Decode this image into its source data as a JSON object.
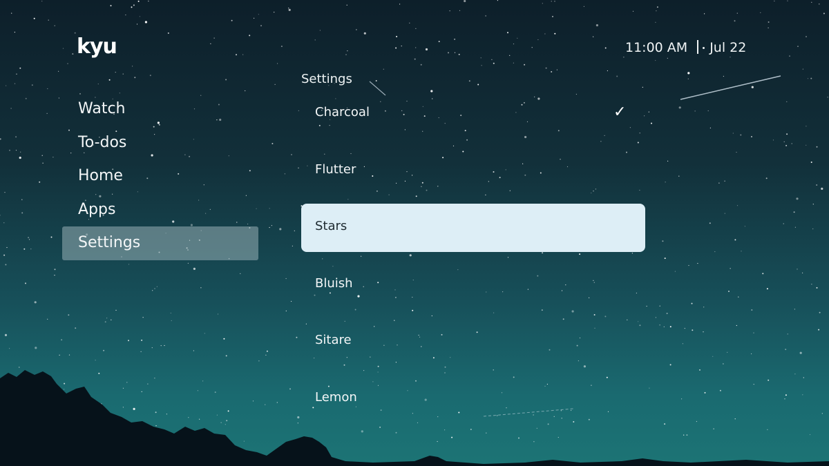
{
  "brand": {
    "logo_text": "kyu"
  },
  "status": {
    "time": "11:00 AM",
    "date": "Jul 22"
  },
  "nav": {
    "items": [
      {
        "label": "Watch"
      },
      {
        "label": "To-dos"
      },
      {
        "label": "Home"
      },
      {
        "label": "Apps"
      },
      {
        "label": "Settings"
      }
    ],
    "active_item": "Settings"
  },
  "settings_panel": {
    "title": "Settings",
    "options": [
      {
        "label": "Charcoal"
      },
      {
        "label": "Flutter"
      },
      {
        "label": "Stars"
      },
      {
        "label": "Bluish"
      },
      {
        "label": "Sitare"
      },
      {
        "label": "Lemon"
      }
    ],
    "selected_option": "Charcoal",
    "focused_option": "Stars",
    "check_glyph": "✓"
  },
  "theme": {
    "focus_background": "#ddeef6",
    "active_nav_background": "#b4c8cd",
    "text_color": "#f3f6f7"
  }
}
